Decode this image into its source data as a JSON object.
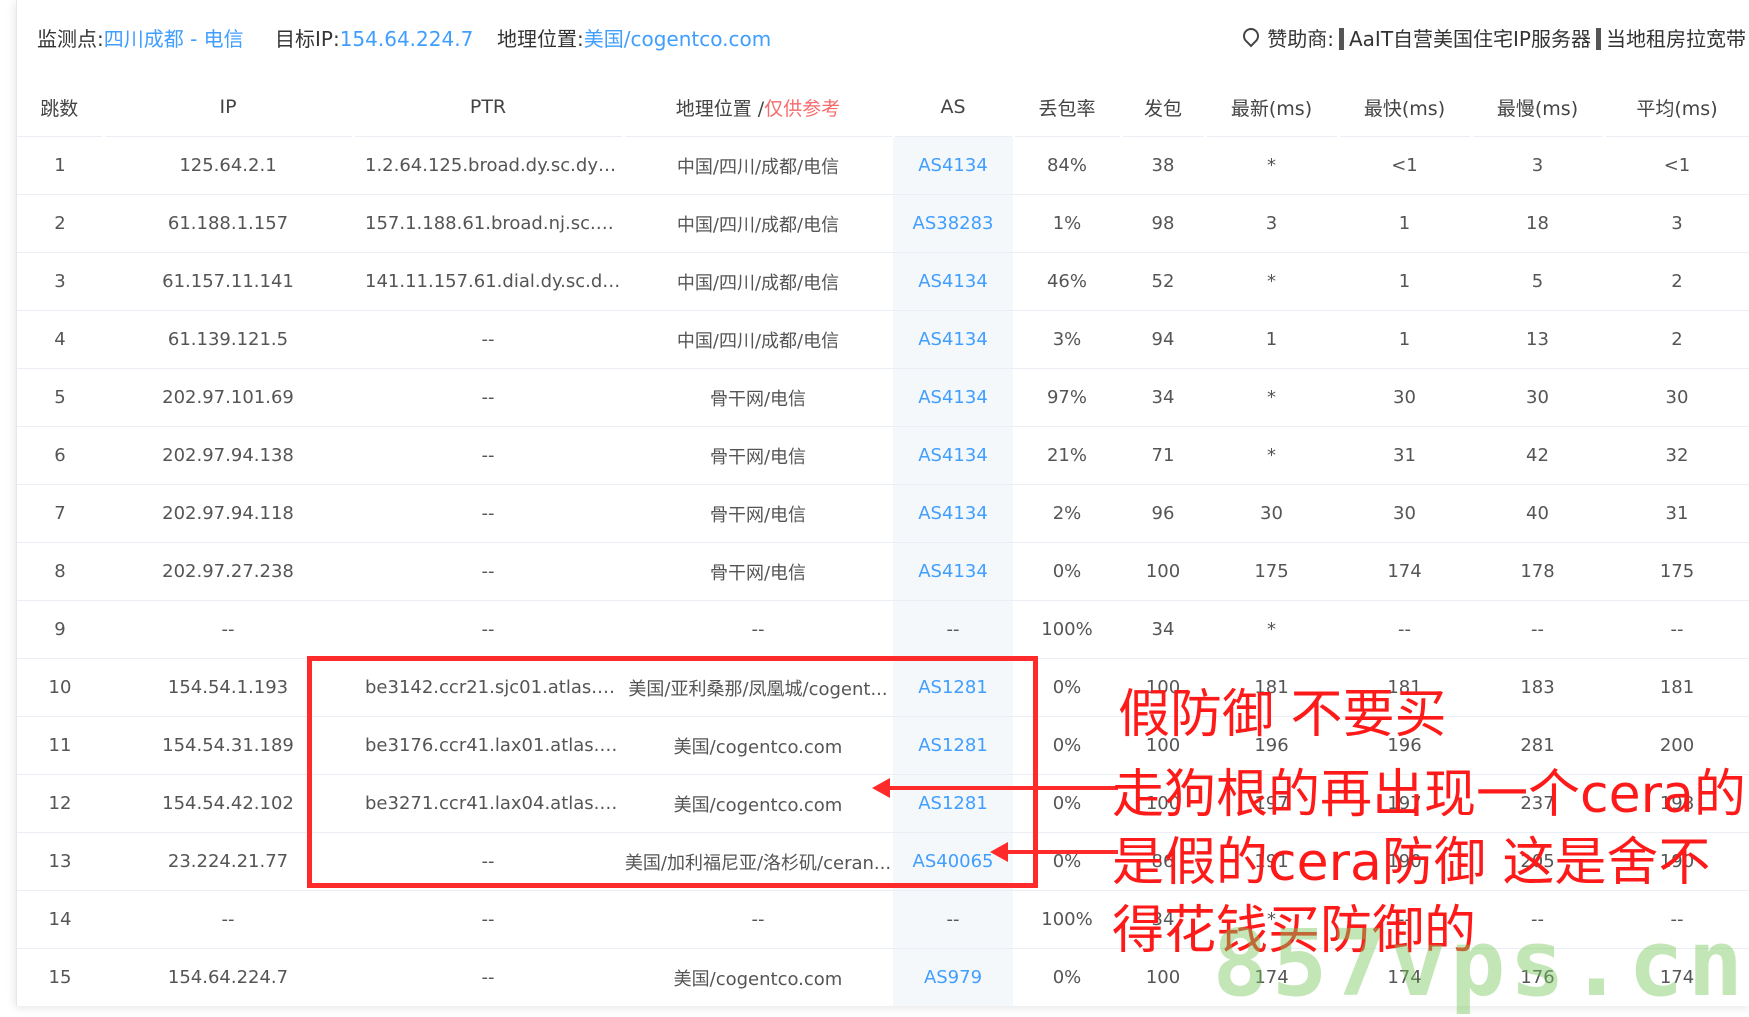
{
  "infobar": {
    "monitor_label": "监测点:",
    "monitor_value": "四川成都 - 电信",
    "target_label": "目标IP:",
    "target_value": "154.64.224.7",
    "geo_label": "地理位置:",
    "geo_value": "美国/cogentco.com",
    "sponsor_label": "赞助商:",
    "sponsor_1": "AaIT自营美国住宅IP服务器",
    "sponsor_2": "当地租房拉宽带"
  },
  "table": {
    "headers": {
      "hop": "跳数",
      "ip": "IP",
      "ptr": "PTR",
      "geo": "地理位置 /",
      "geo_note": "仅供参考",
      "as": "AS",
      "loss": "丢包率",
      "sent": "发包",
      "last": "最新(ms)",
      "best": "最快(ms)",
      "worst": "最慢(ms)",
      "avg": "平均(ms)"
    },
    "rows": [
      {
        "hop": "1",
        "ip": "125.64.2.1",
        "ptr": "1.2.64.125.broad.dy.sc.dyna...",
        "geo": "中国/四川/成都/电信",
        "as": "AS4134",
        "loss": "84%",
        "sent": "38",
        "last": "*",
        "best": "<1",
        "worst": "3",
        "avg": "<1"
      },
      {
        "hop": "2",
        "ip": "61.188.1.157",
        "ptr": "157.1.188.61.broad.nj.sc.dyn...",
        "geo": "中国/四川/成都/电信",
        "as": "AS38283",
        "loss": "1%",
        "sent": "98",
        "last": "3",
        "best": "1",
        "worst": "18",
        "avg": "3"
      },
      {
        "hop": "3",
        "ip": "61.157.11.141",
        "ptr": "141.11.157.61.dial.dy.sc.dyna...",
        "geo": "中国/四川/成都/电信",
        "as": "AS4134",
        "loss": "46%",
        "sent": "52",
        "last": "*",
        "best": "1",
        "worst": "5",
        "avg": "2"
      },
      {
        "hop": "4",
        "ip": "61.139.121.5",
        "ptr": "--",
        "geo": "中国/四川/成都/电信",
        "as": "AS4134",
        "loss": "3%",
        "sent": "94",
        "last": "1",
        "best": "1",
        "worst": "13",
        "avg": "2"
      },
      {
        "hop": "5",
        "ip": "202.97.101.69",
        "ptr": "--",
        "geo": "骨干网/电信",
        "as": "AS4134",
        "loss": "97%",
        "sent": "34",
        "last": "*",
        "best": "30",
        "worst": "30",
        "avg": "30"
      },
      {
        "hop": "6",
        "ip": "202.97.94.138",
        "ptr": "--",
        "geo": "骨干网/电信",
        "as": "AS4134",
        "loss": "21%",
        "sent": "71",
        "last": "*",
        "best": "31",
        "worst": "42",
        "avg": "32"
      },
      {
        "hop": "7",
        "ip": "202.97.94.118",
        "ptr": "--",
        "geo": "骨干网/电信",
        "as": "AS4134",
        "loss": "2%",
        "sent": "96",
        "last": "30",
        "best": "30",
        "worst": "40",
        "avg": "31"
      },
      {
        "hop": "8",
        "ip": "202.97.27.238",
        "ptr": "--",
        "geo": "骨干网/电信",
        "as": "AS4134",
        "loss": "0%",
        "sent": "100",
        "last": "175",
        "best": "174",
        "worst": "178",
        "avg": "175"
      },
      {
        "hop": "9",
        "ip": "--",
        "ptr": "--",
        "geo": "--",
        "as": "--",
        "loss": "100%",
        "sent": "34",
        "last": "*",
        "best": "--",
        "worst": "--",
        "avg": "--"
      },
      {
        "hop": "10",
        "ip": "154.54.1.193",
        "ptr": "be3142.ccr21.sjc01.atlas.cog...",
        "geo": "美国/亚利桑那/凤凰城/cogent...",
        "as": "AS1281",
        "loss": "0%",
        "sent": "100",
        "last": "181",
        "best": "181",
        "worst": "183",
        "avg": "181"
      },
      {
        "hop": "11",
        "ip": "154.54.31.189",
        "ptr": "be3176.ccr41.lax01.atlas.cog...",
        "geo": "美国/cogentco.com",
        "as": "AS1281",
        "loss": "0%",
        "sent": "100",
        "last": "196",
        "best": "196",
        "worst": "281",
        "avg": "200"
      },
      {
        "hop": "12",
        "ip": "154.54.42.102",
        "ptr": "be3271.ccr41.lax04.atlas.cog...",
        "geo": "美国/cogentco.com",
        "as": "AS1281",
        "loss": "0%",
        "sent": "100",
        "last": "197",
        "best": "197",
        "worst": "237",
        "avg": "198"
      },
      {
        "hop": "13",
        "ip": "23.224.21.77",
        "ptr": "--",
        "geo": "美国/加利福尼亚/洛杉矶/ceran...",
        "as": "AS40065",
        "loss": "0%",
        "sent": "86",
        "last": "191",
        "best": "190",
        "worst": "205",
        "avg": "190"
      },
      {
        "hop": "14",
        "ip": "--",
        "ptr": "--",
        "geo": "--",
        "as": "--",
        "loss": "100%",
        "sent": "34",
        "last": "*",
        "best": "--",
        "worst": "--",
        "avg": "--"
      },
      {
        "hop": "15",
        "ip": "154.64.224.7",
        "ptr": "--",
        "geo": "美国/cogentco.com",
        "as": "AS979",
        "loss": "0%",
        "sent": "100",
        "last": "174",
        "best": "174",
        "worst": "176",
        "avg": "174"
      }
    ]
  },
  "annotation": {
    "line1": "假防御   不要买",
    "line2": "走狗根的再出现一个cera的",
    "line3": "是假的cera防御 这是舍不",
    "line4": "得花钱买防御的"
  },
  "watermark": "857vps.cn",
  "colors": {
    "link": "#409eff",
    "note_red": "#f56c6c",
    "annotation_red": "#ff1a1a",
    "watermark_green": "#78c85a"
  }
}
